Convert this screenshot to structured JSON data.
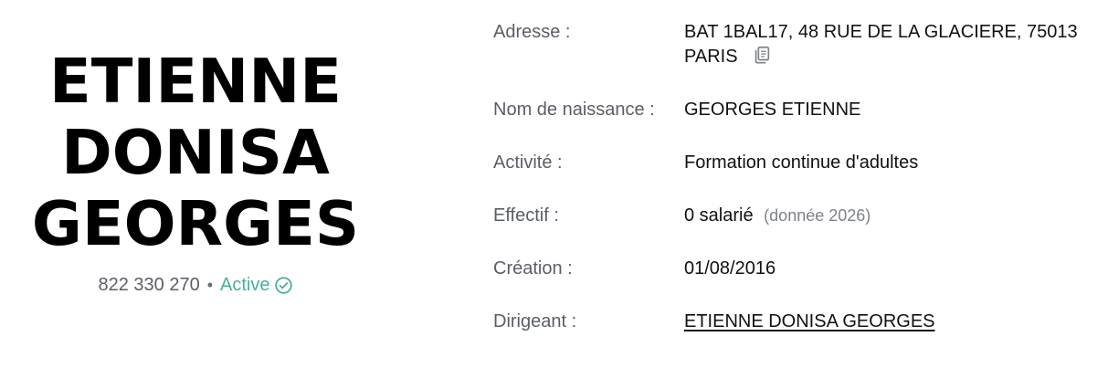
{
  "company": {
    "name_lines": [
      "ETIENNE",
      "DONISA",
      "GEORGES"
    ],
    "siren": "822 330 270",
    "separator": "•",
    "status_label": "Active",
    "status_color": "#4aae9b",
    "status_icon": "check-circle-icon"
  },
  "details": {
    "address": {
      "label": "Adresse :",
      "value_line1": "BAT 1BAL17, 48 RUE DE LA GLACIERE, 75013",
      "value_line2": "PARIS",
      "copy_icon": "copy-icon"
    },
    "birth_name": {
      "label": "Nom de naissance :",
      "value": "GEORGES ETIENNE"
    },
    "activity": {
      "label": "Activité :",
      "value": "Formation continue d'adultes"
    },
    "headcount": {
      "label": "Effectif :",
      "value": "0 salarié",
      "note": "(donnée 2026)"
    },
    "creation": {
      "label": "Création :",
      "value": "01/08/2016"
    },
    "director": {
      "label": "Dirigeant :",
      "value": "ETIENNE DONISA GEORGES"
    }
  }
}
